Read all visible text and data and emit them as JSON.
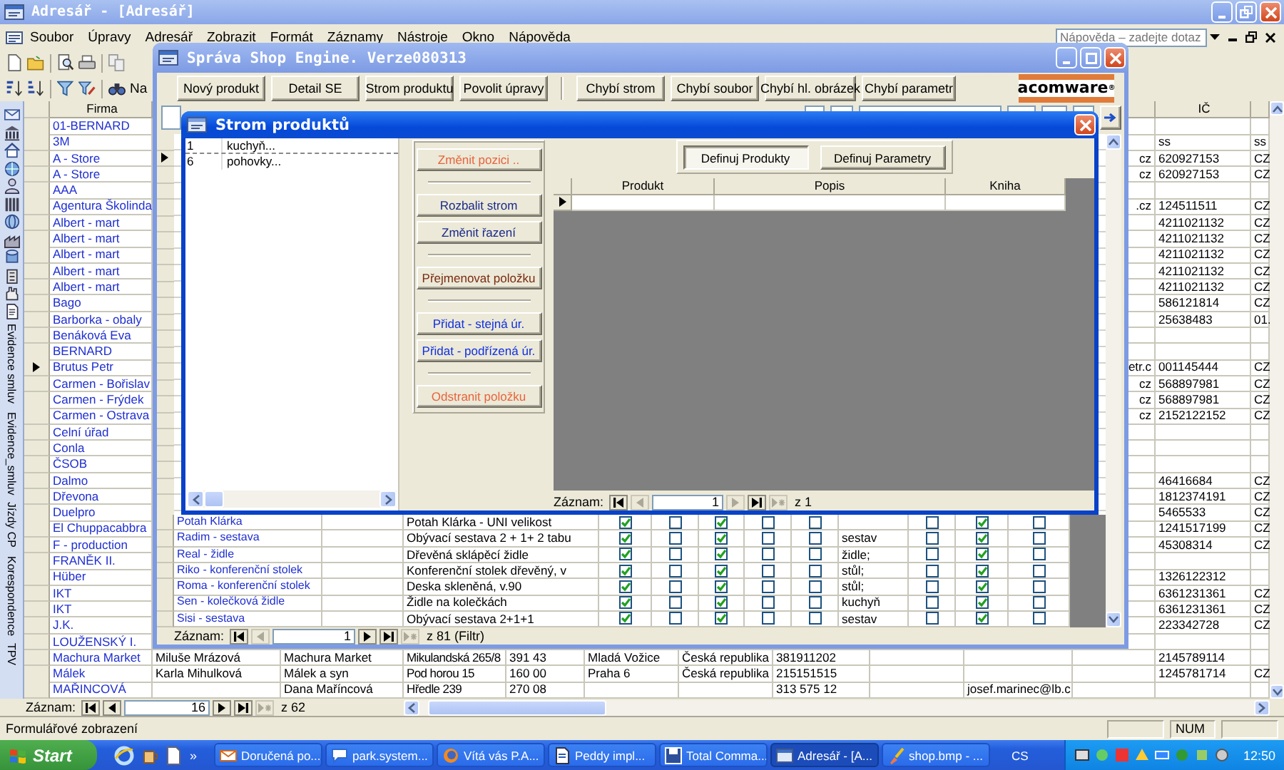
{
  "main_window": {
    "title": "Adresář - [Adresář]",
    "menu": [
      "Soubor",
      "Úpravy",
      "Adresář",
      "Zobrazit",
      "Formát",
      "Záznamy",
      "Nástroje",
      "Okno",
      "Nápověda"
    ],
    "help_box": {
      "placeholder": "Nápověda – zadejte dotaz"
    },
    "toolbar_label": "Na",
    "side_tabs": [
      "Evidence smluv",
      "Evidence_smluv",
      "Jízdy CP",
      "Korespondence",
      "TPV"
    ],
    "columns": {
      "firma": "Firma",
      "ic": "IČ"
    },
    "rows": [
      {
        "firma": "01-BERNARD",
        "current": false
      },
      {
        "firma": "3M",
        "current": false,
        "ic": "ss",
        "column_13": "ss"
      },
      {
        "firma": "A - Store",
        "current": false,
        "column_11": "cz",
        "ic": "620927153",
        "column_13": "CZ"
      },
      {
        "firma": "A - Store",
        "current": false,
        "column_11": "cz",
        "ic": "620927153",
        "column_13": "CZ"
      },
      {
        "firma": "AAA",
        "current": false
      },
      {
        "firma": "Agentura Školinda",
        "current": false,
        "column_11": ".cz",
        "ic": "124511511",
        "column_13": "CZ"
      },
      {
        "firma": "Albert - mart",
        "current": false,
        "ic": "4211021132",
        "column_13": "CZ"
      },
      {
        "firma": "Albert - mart",
        "current": false,
        "ic": "4211021132",
        "column_13": "CZ"
      },
      {
        "firma": "Albert - mart",
        "current": false,
        "ic": "4211021132",
        "column_13": "CZ"
      },
      {
        "firma": "Albert - mart",
        "current": false,
        "ic": "4211021132",
        "column_13": "CZ"
      },
      {
        "firma": "Albert - mart",
        "current": false,
        "ic": "4211021132",
        "column_13": "CZ"
      },
      {
        "firma": "Bago",
        "current": false,
        "ic": "586121814",
        "column_13": "CZ"
      },
      {
        "firma": "Barborka - obaly",
        "current": false,
        "ic": "25638483",
        "column_13": "01."
      },
      {
        "firma": "Benáková Eva",
        "current": false
      },
      {
        "firma": "BERNARD",
        "current": false
      },
      {
        "firma": "Brutus Petr",
        "current": true,
        "column_11": "etr.c",
        "ic": "001145444",
        "column_13": "CZ"
      },
      {
        "firma": "Carmen - Bořislav",
        "current": false,
        "column_11": "cz",
        "ic": "568897981",
        "column_13": "CZ"
      },
      {
        "firma": "Carmen - Frýdek",
        "current": false,
        "column_11": "cz",
        "ic": "568897981",
        "column_13": "CZ"
      },
      {
        "firma": "Carmen - Ostrava",
        "current": false,
        "column_11": "cz",
        "ic": "2152122152",
        "column_13": "CZ"
      },
      {
        "firma": "Celní úřad",
        "current": false
      },
      {
        "firma": "Conla",
        "current": false
      },
      {
        "firma": "ČSOB",
        "current": false
      },
      {
        "firma": "Dalmo",
        "current": false,
        "ic": "46416684",
        "column_13": "CZ"
      },
      {
        "firma": "Dřevona",
        "current": false,
        "ic": "1812374191",
        "column_13": "CZ"
      },
      {
        "firma": "Duelpro",
        "current": false,
        "ic": "5465533",
        "column_13": "CZ"
      },
      {
        "firma": "El Chuppacabbra",
        "current": false,
        "ic": "1241517199",
        "column_13": "CZ"
      },
      {
        "firma": "F - production",
        "current": false,
        "ic": "45308314",
        "column_13": "CZ"
      },
      {
        "firma": "FRANĚK II.",
        "current": false
      },
      {
        "firma": "Hüber",
        "current": false,
        "ic": "1326122312"
      },
      {
        "firma": "IKT",
        "current": false,
        "ic": "6361231361",
        "column_13": "CZ"
      },
      {
        "firma": "IKT",
        "current": false,
        "ic": "6361231361",
        "column_13": "CZ"
      },
      {
        "firma": "J.K.",
        "current": false,
        "ic": "223342728",
        "column_13": "CZ"
      },
      {
        "firma": "LOUŽENSKÝ I.",
        "current": false
      },
      {
        "firma": "Machura Market",
        "current": false,
        "column_2": "Miluše Mrázová",
        "column_3": "Machura Market",
        "column_4": "Mikulandská 265/8",
        "column_5": "391 43",
        "column_6": "Mladá Vožice",
        "column_7": "Česká republika",
        "column_8": "381911202",
        "ic": "2145789114"
      },
      {
        "firma": "Málek",
        "current": false,
        "column_2": "Karla Mihulková",
        "column_3": "Málek a syn",
        "column_4": "Pod horou 15",
        "column_5": "160 00",
        "column_6": "Praha 6",
        "column_7": "Česká republika",
        "column_8": "215151515",
        "ic": "1245781714",
        "column_13": "CZ"
      },
      {
        "firma": "MAŘINCOVÁ",
        "current": false,
        "column_3": "Dana Maříncová",
        "column_4": "Hředle 239",
        "column_5": "270 08",
        "column_8": "313 575 12",
        "column_10": "josef.marinec@lb.c"
      }
    ],
    "navigator": {
      "label": "Záznam:",
      "value": "16",
      "total": "z 62",
      "buttons": [
        {
          "kind": "first",
          "disabled": false
        },
        {
          "kind": "prev",
          "disabled": false
        },
        {
          "kind": "next",
          "disabled": false
        },
        {
          "kind": "last",
          "disabled": false
        },
        {
          "kind": "new",
          "disabled": true
        }
      ]
    },
    "status": "Formulářové zobrazení",
    "indicator": "NUM"
  },
  "shop_window": {
    "title": "Správa Shop Engine. Verze080313",
    "buttons": [
      "Nový produkt",
      "Detail SE",
      "Strom produktu",
      "Povolit úpravy",
      "Chybí strom",
      "Chybí soubor",
      "Chybí hl. obrázek",
      "Chybí parametr"
    ],
    "logo": "acomware$^{®}$",
    "current_marker": true,
    "rows": [
      {
        "name": "Potah Klárka",
        "description": "Potah Klárka - UNI velikost",
        "checks": [
          true,
          false,
          true,
          false,
          false
        ],
        "checks_2": [
          false,
          true,
          false
        ]
      },
      {
        "name": "Radim - sestava",
        "description": "Obývací sestava 2 + 1+ 2 tabu",
        "checks": [
          true,
          false,
          true,
          false,
          false
        ],
        "category": "sestav",
        "checks_2": [
          false,
          true,
          false
        ]
      },
      {
        "name": "Real - židle",
        "description": "Dřevěná sklápěcí židle",
        "checks": [
          true,
          false,
          true,
          false,
          false
        ],
        "category": "židle;",
        "checks_2": [
          false,
          true,
          false
        ]
      },
      {
        "name": "Riko - konferenční stolek",
        "description": "Konferenční stolek dřevěný, v",
        "checks": [
          true,
          false,
          true,
          false,
          false
        ],
        "category": "stůl;",
        "checks_2": [
          false,
          true,
          false
        ]
      },
      {
        "name": "Roma - konferenční stolek",
        "description": "Deska skleněná, v.90",
        "checks": [
          true,
          false,
          true,
          false,
          false
        ],
        "category": "stůl;",
        "checks_2": [
          false,
          true,
          false
        ]
      },
      {
        "name": "Sen - kolečková židle",
        "description": "Židle na kolečkách",
        "checks": [
          true,
          false,
          true,
          false,
          false
        ],
        "category": "kuchyň",
        "checks_2": [
          false,
          true,
          false
        ]
      },
      {
        "name": "Sisi - sestava",
        "description": "Obývací sestava 2+1+1",
        "checks": [
          true,
          false,
          true,
          false,
          false
        ],
        "category": "sestav",
        "checks_2": [
          false,
          true,
          false
        ]
      }
    ],
    "navigator": {
      "label": "Záznam:",
      "value": "1",
      "total": "z 81 (Filtr)",
      "buttons": [
        {
          "kind": "first",
          "disabled": false
        },
        {
          "kind": "prev",
          "disabled": true
        },
        {
          "kind": "next",
          "disabled": false
        },
        {
          "kind": "last",
          "disabled": false
        },
        {
          "kind": "new",
          "disabled": true
        }
      ]
    }
  },
  "tree_dialog": {
    "title": "Strom produktů",
    "tree": [
      {
        "number": "1",
        "label": "kuchyň..."
      },
      {
        "number": "6",
        "label": "pohovky..."
      }
    ],
    "actions": [
      {
        "kind": "button",
        "label": "Změnit pozici ..",
        "color": "#e8643c"
      },
      {
        "kind": "separator"
      },
      {
        "kind": "button",
        "label": "Rozbalit strom",
        "color": "#1a2a8a"
      },
      {
        "kind": "button",
        "label": "Změnit řazení",
        "color": "#1a2a8a"
      },
      {
        "kind": "separator"
      },
      {
        "kind": "button",
        "label": "Přejmenovat položku",
        "color": "#7a2a10"
      },
      {
        "kind": "separator"
      },
      {
        "kind": "button",
        "label": "Přidat - stejná úr.",
        "color": "#1030e0"
      },
      {
        "kind": "button",
        "label": "Přidat - podřízená úr.",
        "color": "#1030e0"
      },
      {
        "kind": "separator"
      },
      {
        "kind": "button",
        "label": "Odstranit položku",
        "color": "#e8643c"
      }
    ],
    "tabs": [
      {
        "label": "Definuj Produkty",
        "selected": true
      },
      {
        "label": "Definuj Parametry",
        "selected": false
      }
    ],
    "columns": [
      "Produkt",
      "Popis",
      "Kniha"
    ],
    "navigator": {
      "label": "Záznam:",
      "value": "1",
      "total": "z 1",
      "buttons": [
        {
          "kind": "first",
          "disabled": false
        },
        {
          "kind": "prev",
          "disabled": true
        },
        {
          "kind": "next",
          "disabled": true
        },
        {
          "kind": "last",
          "disabled": false
        },
        {
          "kind": "new",
          "disabled": true
        }
      ]
    }
  },
  "taskbar": {
    "start": "Start",
    "overflow": "»",
    "tasks": [
      {
        "label": "Doručená po...",
        "selected": false
      },
      {
        "label": "park.system...",
        "selected": false
      },
      {
        "label": "Vítá vás P.A...",
        "selected": false
      },
      {
        "label": "Peddy   impl...",
        "selected": false
      },
      {
        "label": "Total Comma...",
        "selected": false
      },
      {
        "label": "Adresář - [A...",
        "selected": true
      },
      {
        "label": "shop.bmp - ...",
        "selected": false
      }
    ],
    "language": "CS",
    "clock": "12:50"
  }
}
